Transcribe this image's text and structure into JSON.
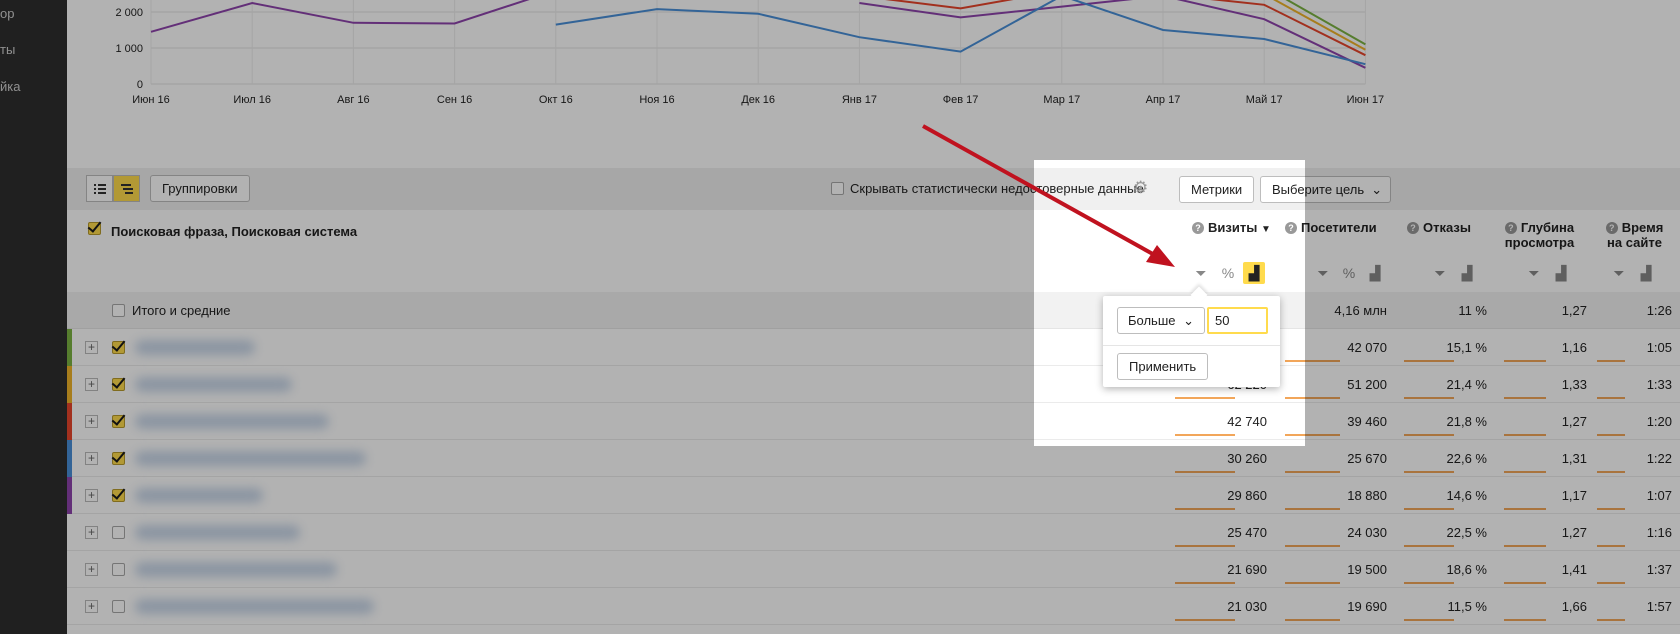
{
  "sidebar": {
    "items": [
      "ор",
      "ты",
      "йка"
    ]
  },
  "chart_data": {
    "type": "line",
    "x": [
      "Июн 16",
      "Июл 16",
      "Авг 16",
      "Сен 16",
      "Окт 16",
      "Ноя 16",
      "Дек 16",
      "Янв 17",
      "Фев 17",
      "Мар 17",
      "Апр 17",
      "Май 17",
      "Июн 17"
    ],
    "y_ticks": [
      "0",
      "1 000",
      "2 000"
    ],
    "ylim": [
      0,
      2500
    ],
    "series": [
      {
        "color": "#8e44ad",
        "values": [
          1450,
          2250,
          1700,
          1680,
          2600,
          null,
          null,
          2250,
          1850,
          2150,
          2450,
          1800,
          450
        ]
      },
      {
        "color": "#4a90d9",
        "values": [
          null,
          null,
          null,
          null,
          1650,
          2080,
          1950,
          1300,
          900,
          2450,
          1500,
          1250,
          550
        ]
      },
      {
        "color": "#e8452c",
        "values": [
          null,
          null,
          null,
          null,
          null,
          null,
          null,
          2450,
          2100,
          2600,
          2500,
          2200,
          800
        ]
      },
      {
        "color": "#7cb342",
        "values": [
          null,
          null,
          null,
          null,
          null,
          null,
          null,
          null,
          null,
          null,
          null,
          2700,
          1100
        ]
      },
      {
        "color": "#f0b429",
        "values": [
          null,
          null,
          null,
          null,
          null,
          null,
          null,
          null,
          null,
          null,
          null,
          2500,
          950
        ]
      }
    ]
  },
  "toolbar": {
    "groupings_label": "Группировки",
    "hide_label": "Скрывать статистически недостоверные данные",
    "metrics_label": "Метрики",
    "goal_label": "Выберите цель"
  },
  "table": {
    "dimension_header": "Поисковая фраза, Поисковая система",
    "columns": [
      "Визиты",
      "Посетители",
      "Отказы",
      "Глубина просмотра",
      "Время на сайте"
    ],
    "columns_line2": [
      "",
      "",
      "",
      "просмотра",
      "на сайте"
    ],
    "columns_line1": [
      "Визиты",
      "Посетители",
      "Отказы",
      "Глубина",
      "Время"
    ],
    "totals_label": "Итого и средние",
    "totals": [
      "",
      "4,16 млн",
      "11 %",
      "1,27",
      "1:26"
    ],
    "rows": [
      {
        "stripe": "#7cb342",
        "checked": true,
        "cells": [
          "",
          "42 070",
          "15,1 %",
          "1,16",
          "1:05"
        ]
      },
      {
        "stripe": "#f0b429",
        "checked": true,
        "cells": [
          "62 220",
          "51 200",
          "21,4 %",
          "1,33",
          "1:33"
        ]
      },
      {
        "stripe": "#e8452c",
        "checked": true,
        "cells": [
          "42 740",
          "39 460",
          "21,8 %",
          "1,27",
          "1:20"
        ]
      },
      {
        "stripe": "#4a90d9",
        "checked": true,
        "cells": [
          "30 260",
          "25 670",
          "22,6 %",
          "1,31",
          "1:22"
        ]
      },
      {
        "stripe": "#8e44ad",
        "checked": true,
        "cells": [
          "29 860",
          "18 880",
          "14,6 %",
          "1,17",
          "1:07"
        ]
      },
      {
        "stripe": "",
        "checked": false,
        "cells": [
          "25 470",
          "24 030",
          "22,5 %",
          "1,27",
          "1:16"
        ]
      },
      {
        "stripe": "",
        "checked": false,
        "cells": [
          "21 690",
          "19 500",
          "18,6 %",
          "1,41",
          "1:37"
        ]
      },
      {
        "stripe": "",
        "checked": false,
        "cells": [
          "21 030",
          "19 690",
          "11,5 %",
          "1,66",
          "1:57"
        ]
      }
    ]
  },
  "popup": {
    "condition": "Больше",
    "value": "50",
    "apply_label": "Применить"
  },
  "colors": {
    "accent": "#ffdb4d",
    "arrow": "#c0121f",
    "bar": "#f2a65a"
  }
}
